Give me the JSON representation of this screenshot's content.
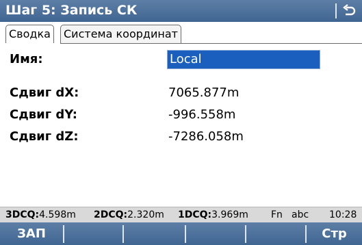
{
  "header": {
    "title": "Шаг 5: Запись СК",
    "back_icon": "back-arrow-icon"
  },
  "tabs": [
    {
      "label": "Сводка",
      "active": true
    },
    {
      "label": "Система координат",
      "active": false
    }
  ],
  "form": {
    "name_label": "Имя:",
    "name_value": "Local",
    "shift_dx_label": "Сдвиг dX:",
    "shift_dx_value": "7065.877m",
    "shift_dy_label": "Сдвиг dY:",
    "shift_dy_value": "-996.558m",
    "shift_dz_label": "Сдвиг dZ:",
    "shift_dz_value": "-7286.058m"
  },
  "status": {
    "dcq3_label": "3DCQ:",
    "dcq3_value": "4.598m",
    "dcq2_label": "2DCQ:",
    "dcq2_value": "2.320m",
    "dcq1_label": "1DCQ:",
    "dcq1_value": "3.969m",
    "fn": "Fn",
    "input_mode": "abc",
    "time": "10:28"
  },
  "function_keys": [
    "ЗАП",
    "",
    "",
    "",
    "",
    "Стр"
  ],
  "colors": {
    "bar": "#4a6f99",
    "selection": "#1b5fbe"
  }
}
